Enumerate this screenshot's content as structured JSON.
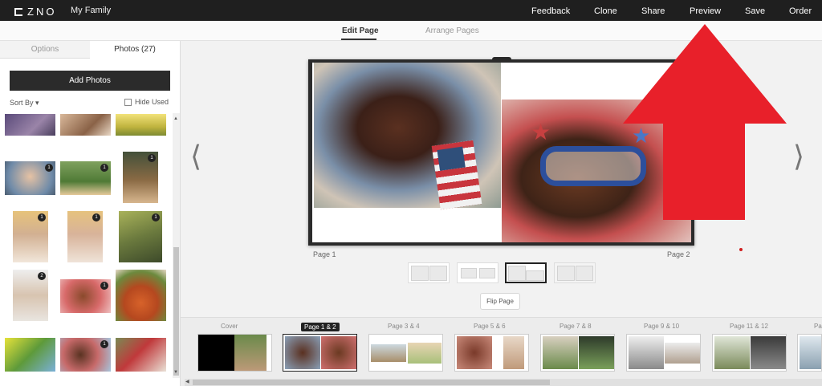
{
  "app": {
    "logo_text": "ZNO",
    "project_name": "My Family"
  },
  "topnav": [
    "Feedback",
    "Clone",
    "Share",
    "Preview",
    "Save",
    "Order"
  ],
  "subtabs": {
    "edit": "Edit Page",
    "arrange": "Arrange Pages"
  },
  "panel": {
    "tab_options": "Options",
    "tab_photos": "Photos (27)",
    "add_photos": "Add Photos",
    "sort_by": "Sort By",
    "hide_used": "Hide Used",
    "badges": [
      "1",
      "1",
      "1",
      "1",
      "1",
      "1",
      "2",
      "1"
    ]
  },
  "spread": {
    "page_left_label": "Page 1",
    "page_right_label": "Page 2",
    "flip_page": "Flip Page"
  },
  "filmstrip": {
    "labels": [
      "Cover",
      "Page 1 & 2",
      "Page 3 & 4",
      "Page 5 & 6",
      "Page 7 & 8",
      "Page 9 & 10",
      "Page 11 & 12",
      "Pa"
    ]
  },
  "colors": {
    "topbar": "#1f1f1f",
    "annotation": "#e8202a"
  }
}
